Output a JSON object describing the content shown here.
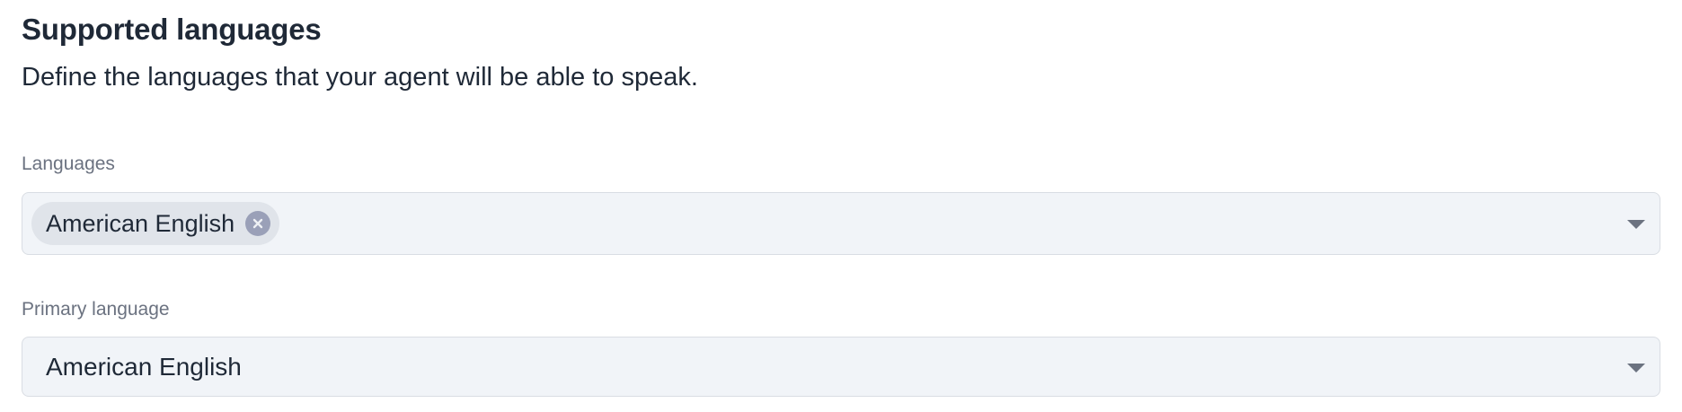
{
  "section": {
    "title": "Supported languages",
    "description": "Define the languages that your agent will be able to speak."
  },
  "languages_field": {
    "label": "Languages",
    "selected_chips": [
      {
        "label": "American English",
        "remove_icon": "close-circle-icon"
      }
    ],
    "dropdown_icon": "chevron-down-icon"
  },
  "primary_language_field": {
    "label": "Primary language",
    "value": "American English",
    "dropdown_icon": "chevron-down-icon"
  },
  "colors": {
    "input_background": "#f1f4f8",
    "input_border": "#d9dde3",
    "chip_background": "#e0e4ea",
    "chip_remove_icon": "#9aa0b8",
    "label_text": "#6b7280",
    "primary_text": "#1f2937"
  }
}
